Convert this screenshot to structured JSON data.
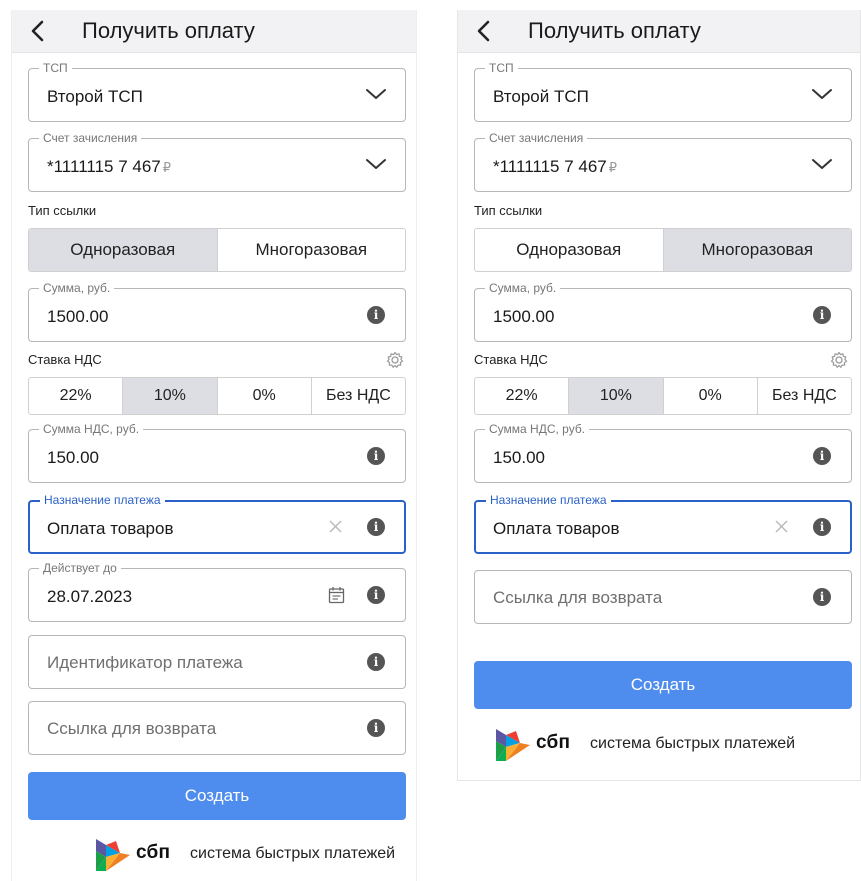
{
  "screens": [
    {
      "title": "Получить оплату",
      "tsp": {
        "legend": "ТСП",
        "value": "Второй ТСП"
      },
      "account": {
        "legend": "Счет зачисления",
        "value": "*1111115  7 467",
        "currency": "₽"
      },
      "link_type": {
        "label": "Тип ссылки",
        "options": [
          "Одноразовая",
          "Многоразовая"
        ],
        "selected": "Одноразовая"
      },
      "amount": {
        "legend": "Сумма, руб.",
        "value": "1500.00"
      },
      "vat": {
        "label": "Ставка НДС",
        "options": [
          "22%",
          "10%",
          "0%",
          "Без НДС"
        ],
        "selected": "10%"
      },
      "vat_amount": {
        "legend": "Сумма НДС, руб.",
        "value": "150.00"
      },
      "purpose": {
        "legend": "Назначение платежа",
        "value": "Оплата товаров"
      },
      "valid_until": {
        "legend": "Действует до",
        "value": "28.07.2023"
      },
      "payment_id": {
        "placeholder": "Идентификатор платежа"
      },
      "return_link": {
        "placeholder": "Ссылка для возврата"
      },
      "create_label": "Создать",
      "sbp": {
        "short": "сбп",
        "full": "система быстрых платежей"
      }
    },
    {
      "title": "Получить оплату",
      "tsp": {
        "legend": "ТСП",
        "value": "Второй ТСП"
      },
      "account": {
        "legend": "Счет зачисления",
        "value": "*1111115  7 467",
        "currency": "₽"
      },
      "link_type": {
        "label": "Тип ссылки",
        "options": [
          "Одноразовая",
          "Многоразовая"
        ],
        "selected": "Многоразовая"
      },
      "amount": {
        "legend": "Сумма, руб.",
        "value": "1500.00"
      },
      "vat": {
        "label": "Ставка НДС",
        "options": [
          "22%",
          "10%",
          "0%",
          "Без НДС"
        ],
        "selected": "10%"
      },
      "vat_amount": {
        "legend": "Сумма НДС, руб.",
        "value": "150.00"
      },
      "purpose": {
        "legend": "Назначение платежа",
        "value": "Оплата товаров"
      },
      "return_link": {
        "placeholder": "Ссылка для возврата"
      },
      "create_label": "Создать",
      "sbp": {
        "short": "сбп",
        "full": "система быстрых платежей"
      }
    }
  ],
  "colors": {
    "accent_blue": "#4e8ded",
    "focus_blue": "#2a61c8",
    "segment_active": "#dcdee3",
    "header_bg": "#f2f2f4",
    "info_icon": "#555555"
  },
  "icons": [
    "back-icon",
    "chevron-down-icon",
    "info-icon",
    "clear-icon",
    "calendar-icon",
    "gear-icon",
    "sbp-logo"
  ]
}
